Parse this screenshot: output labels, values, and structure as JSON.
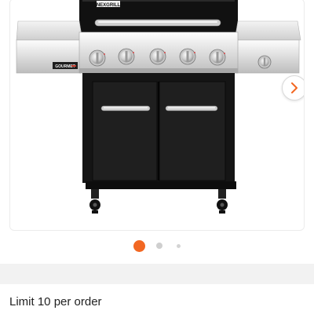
{
  "product": {
    "name": "Nexgrill 5-burner gas grill",
    "brand_on_lid": "NEXGRILL",
    "series_badge": "GOURMET",
    "color": "#111111"
  },
  "carousel": {
    "total_dots": 3,
    "active_index": 0,
    "active_color": "#f26722",
    "next_icon": "chevron-right-icon",
    "next_icon_color": "#f26722"
  },
  "purchase": {
    "limit_text": "Limit 10 per order"
  }
}
